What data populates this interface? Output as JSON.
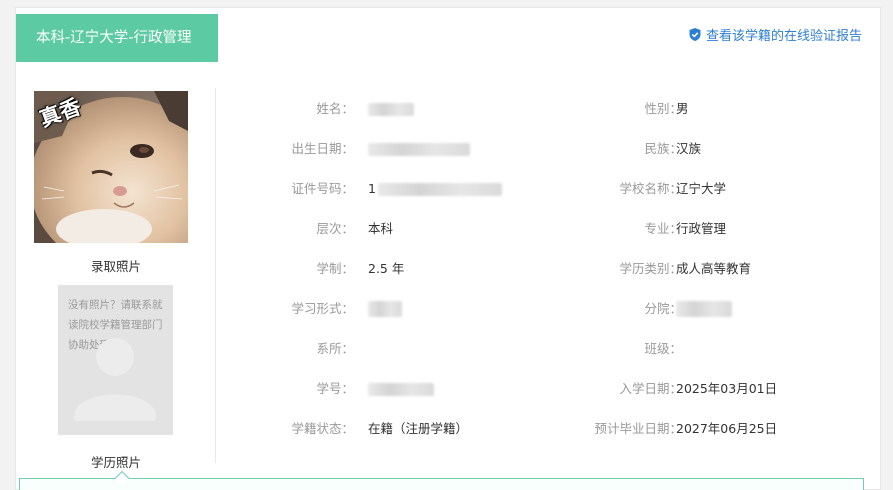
{
  "header": {
    "title": "本科-辽宁大学-行政管理",
    "verify_link": "查看该学籍的在线验证报告"
  },
  "left": {
    "admission_photo_caption": "录取照片",
    "admission_photo_overlay": "真香",
    "no_photo_text": "没有照片？请联系就读院校学籍管理部门协助处理!",
    "edu_photo_caption": "学历照片"
  },
  "info": {
    "name_label": "姓名：",
    "gender_label": "性别：",
    "gender_value": "男",
    "birth_label": "出生日期：",
    "ethnicity_label": "民族：",
    "ethnicity_value": "汉族",
    "id_label": "证件号码：",
    "id_value_prefix": "1",
    "school_label": "学校名称：",
    "school_value": "辽宁大学",
    "level_label": "层次：",
    "level_value": "本科",
    "major_label": "专业：",
    "major_value": "行政管理",
    "duration_label": "学制：",
    "duration_value": "2.5 年",
    "edu_type_label": "学历类别：",
    "edu_type_value": "成人高等教育",
    "study_form_label": "学习形式：",
    "branch_label": "分院：",
    "dept_label": "系所：",
    "class_label": "班级：",
    "student_no_label": "学号：",
    "enroll_date_label": "入学日期：",
    "enroll_date_value": "2025年03月01日",
    "status_label": "学籍状态：",
    "status_value": "在籍（注册学籍）",
    "grad_date_label": "预计毕业日期：",
    "grad_date_value": "2027年06月25日"
  },
  "colors": {
    "accent": "#5ccba3",
    "link": "#2f7fd1",
    "label": "#999999"
  },
  "icons": {
    "verify": "shield-check-icon",
    "placeholder": "person-silhouette-icon"
  }
}
